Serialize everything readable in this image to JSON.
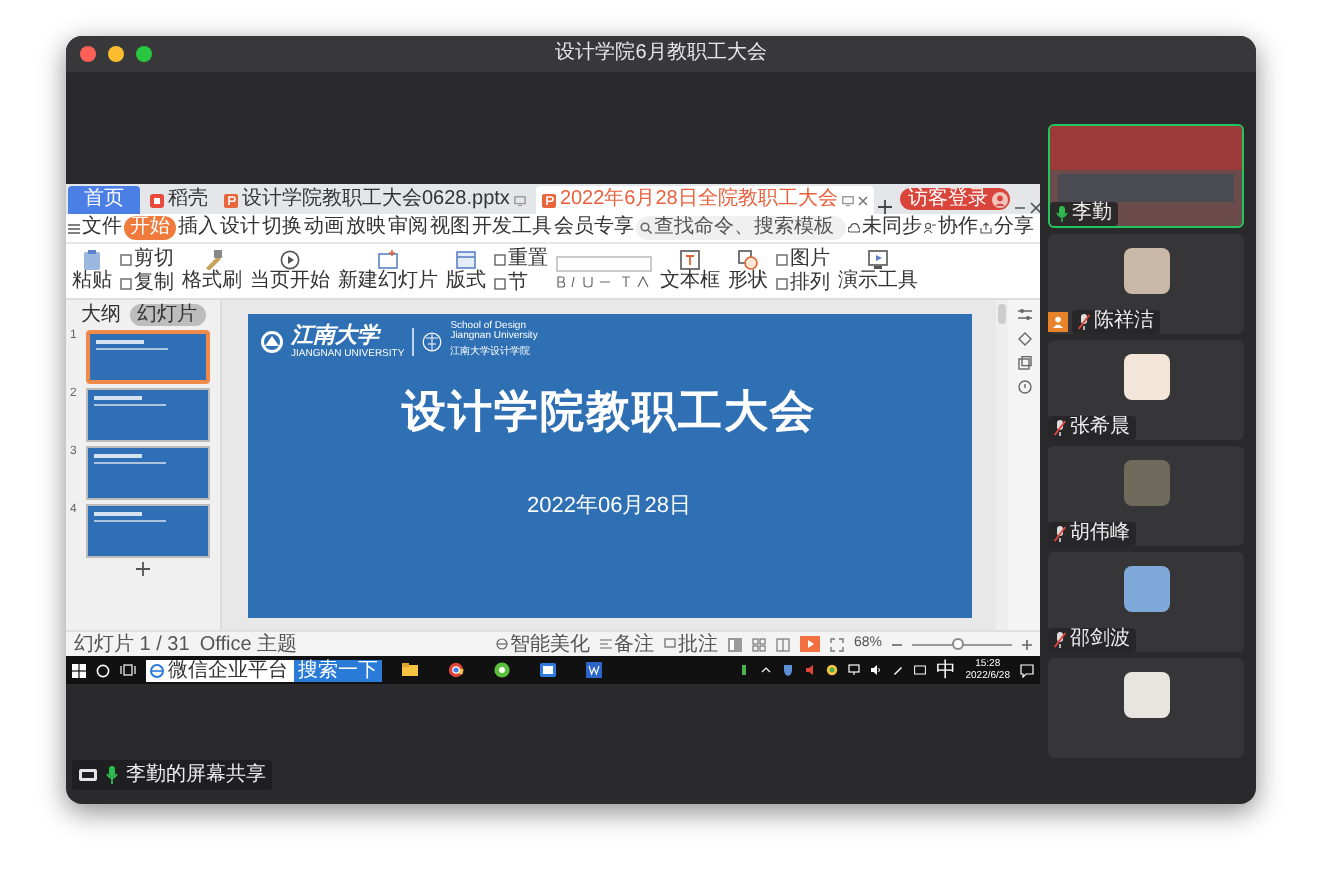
{
  "window": {
    "title": "设计学院6月教职工大会"
  },
  "shared_screen": {
    "app_tabs": [
      {
        "label": "首页",
        "kind": "home",
        "selected": false
      },
      {
        "label": "稻壳",
        "kind": "docer",
        "selected": false
      },
      {
        "label": "设计学院教职工大会0628.pptx",
        "kind": "doc",
        "selected": false
      },
      {
        "label": "2022年6月28日全院教职工大会",
        "kind": "doc",
        "selected": true
      }
    ],
    "login_button": "访客登录",
    "menu": [
      {
        "label": "文件",
        "selected": false
      },
      {
        "label": "开始",
        "selected": true
      },
      {
        "label": "插入",
        "selected": false
      },
      {
        "label": "设计",
        "selected": false
      },
      {
        "label": "切换",
        "selected": false
      },
      {
        "label": "动画",
        "selected": false
      },
      {
        "label": "放映",
        "selected": false
      },
      {
        "label": "审阅",
        "selected": false
      },
      {
        "label": "视图",
        "selected": false
      },
      {
        "label": "开发工具",
        "selected": false
      },
      {
        "label": "会员专享",
        "selected": false
      }
    ],
    "command_search": {
      "placeholder": "查找命令、搜索模板"
    },
    "menu_actions": [
      "未同步",
      "协作",
      "分享"
    ],
    "ribbon": [
      {
        "label": "粘贴",
        "kind": "large"
      },
      {
        "label": "剪切",
        "kind": "small"
      },
      {
        "label": "复制",
        "kind": "small"
      },
      {
        "label": "格式刷",
        "kind": "large"
      },
      {
        "label": "当页开始",
        "kind": "large"
      },
      {
        "label": "新建幻灯片",
        "kind": "large"
      },
      {
        "label": "版式",
        "kind": "large"
      },
      {
        "label": "重置",
        "kind": "small"
      },
      {
        "label": "节",
        "kind": "small"
      },
      {
        "kind": "font"
      },
      {
        "label": "文本框",
        "kind": "large"
      },
      {
        "label": "形状",
        "kind": "large"
      },
      {
        "label": "图片",
        "kind": "small"
      },
      {
        "label": "排列",
        "kind": "small"
      },
      {
        "label": "演示工具",
        "kind": "large"
      }
    ],
    "outline_tabs": [
      {
        "label": "大纲",
        "selected": false
      },
      {
        "label": "幻灯片",
        "selected": true
      }
    ],
    "thumbnails": [
      {
        "number": "1",
        "selected": true
      },
      {
        "number": "2",
        "selected": false
      },
      {
        "number": "3",
        "selected": false
      },
      {
        "number": "4",
        "selected": false
      }
    ],
    "slide": {
      "logo_text": "江南大学",
      "logo_caption": "JIANGNAN UNIVERSITY",
      "school_lines": [
        "School of Design",
        "Jiangnan University",
        "江南大学设计学院"
      ],
      "title": "设计学院教职工大会",
      "date": "2022年06月28日"
    },
    "status_bar": {
      "slide_counter": "幻灯片 1 / 31",
      "theme": "Office 主题",
      "actions": [
        "智能美化",
        "备注",
        "批注"
      ],
      "zoom": "68%",
      "zoom_slider": {
        "level": 0.45
      }
    },
    "taskbar": {
      "search": {
        "value": "微信企业平台"
      },
      "search_button": "搜索一下",
      "ime": "中",
      "time": "15:28",
      "date": "2022/6/28"
    }
  },
  "share_label": "李勤的屏幕共享",
  "participants": [
    {
      "name": "李勤",
      "kind": "video",
      "muted": false,
      "host": false
    },
    {
      "name": "陈祥洁",
      "kind": "avatar",
      "muted": true,
      "host": true
    },
    {
      "name": "张希晨",
      "kind": "avatar",
      "muted": true,
      "host": false
    },
    {
      "name": "胡伟峰",
      "kind": "avatar",
      "muted": true,
      "host": false
    },
    {
      "name": "邵剑波",
      "kind": "avatar",
      "muted": true,
      "host": false
    },
    {
      "kind": "avatar"
    }
  ]
}
